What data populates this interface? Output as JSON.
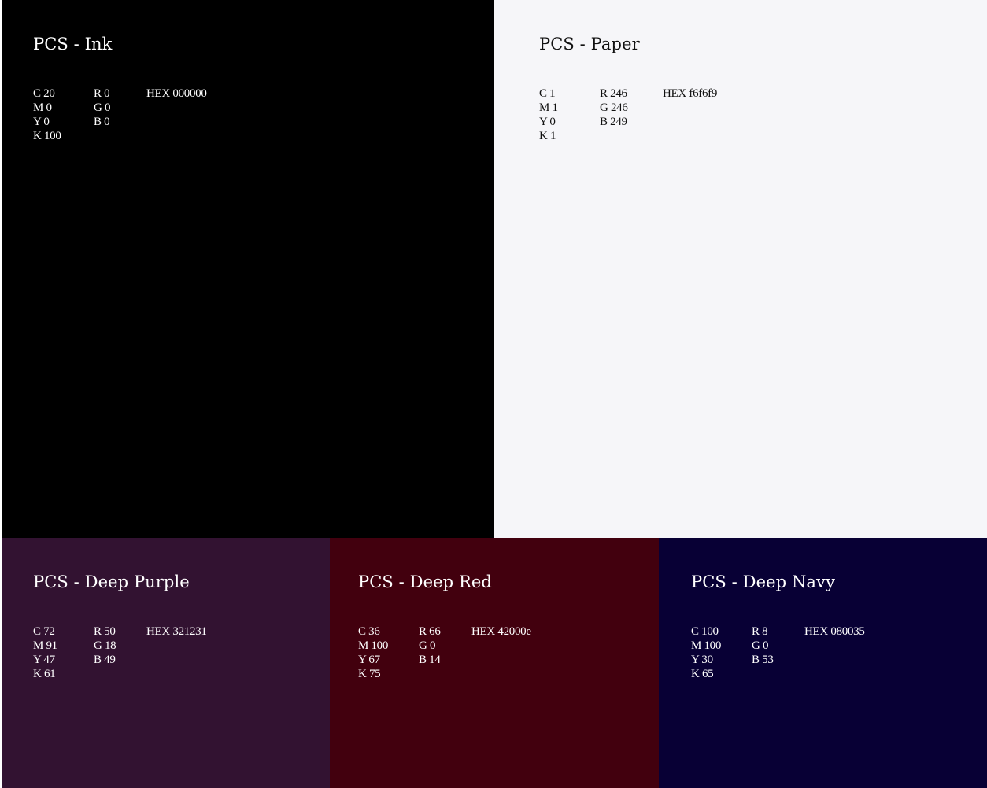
{
  "swatches": [
    {
      "id": "ink",
      "title": "PCS - Ink",
      "background": "#000000",
      "text_color": "#ffffff",
      "cmyk": [
        "C 20",
        "M 0",
        "Y 0",
        "K 100"
      ],
      "rgb": [
        "R 0",
        "G 0",
        "B 0"
      ],
      "hex": "HEX 000000"
    },
    {
      "id": "paper",
      "title": "PCS - Paper",
      "background": "#f6f6f9",
      "text_color": "#111111",
      "cmyk": [
        "C 1",
        "M 1",
        "Y 0",
        "K 1"
      ],
      "rgb": [
        "R 246",
        "G 246",
        "B 249"
      ],
      "hex": "HEX f6f6f9"
    },
    {
      "id": "deep-purple",
      "title": "PCS - Deep Purple",
      "background": "#321231",
      "text_color": "#ffffff",
      "cmyk": [
        "C 72",
        "M 91",
        "Y 47",
        "K 61"
      ],
      "rgb": [
        "R 50",
        "G 18",
        "B 49"
      ],
      "hex": "HEX 321231"
    },
    {
      "id": "deep-red",
      "title": "PCS - Deep Red",
      "background": "#42000e",
      "text_color": "#ffffff",
      "cmyk": [
        "C 36",
        "M 100",
        "Y 67",
        "K 75"
      ],
      "rgb": [
        "R 66",
        "G 0",
        "B 14"
      ],
      "hex": "HEX 42000e"
    },
    {
      "id": "deep-navy",
      "title": "PCS - Deep Navy",
      "background": "#080035",
      "text_color": "#ffffff",
      "cmyk": [
        "C 100",
        "M 100",
        "Y 30",
        "K 65"
      ],
      "rgb": [
        "R 8",
        "G 0",
        "B 53"
      ],
      "hex": "HEX 080035"
    }
  ]
}
